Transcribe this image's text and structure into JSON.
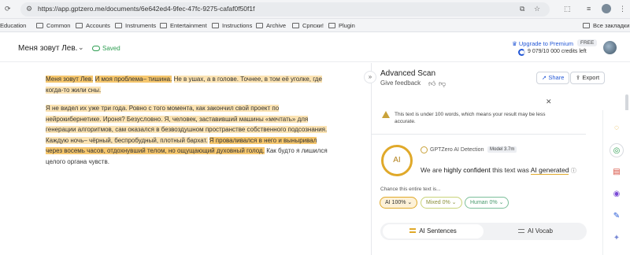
{
  "browser": {
    "url": "https://app.gptzero.me/documents/6e642ed4-9fec-47fc-9275-cafaf0f50f1f",
    "bookmarks": [
      "Education",
      "Common",
      "Accounts",
      "Instruments",
      "Entertainment",
      "Instructions",
      "Archive",
      "Српски!",
      "Plugin"
    ],
    "all_bookmarks": "Все закладки"
  },
  "header": {
    "doc_title": "Меня зовут Лев.",
    "saved": "Saved",
    "upgrade": "Upgrade to Premium",
    "plan_badge": "FREE",
    "credits": "9 079/10 000 credits left"
  },
  "editor": {
    "p1": {
      "s1": "Меня зовут Лев.",
      "s2": "И моя проблема– тишина.",
      "s3": "Не в ушах, а в голове. Точнее, в том её уголке, где когда-то жили сны."
    },
    "p2": {
      "s1": "Я не видел их уже три года. Ровно с того момента, как закончил свой проект по нейрокибернетике. Ироня? Безусловно. Я, человек, заставивший машины «мечтать» для генерации алгоритмов, сам оказался в безвоздушном пространстве собственного подсознания. Каждую ночь– чёрный, беспробудный, плотный бархат.",
      "s2": "Я проваливался в него и выныривал через восемь часов, отдохнувший телом, но ощущающий духовный голод.",
      "s3": "Как будто я лишился целого органа чувств."
    }
  },
  "panel": {
    "title": "Advanced Scan",
    "feedback": "Give feedback",
    "share": "Share",
    "export": "Export",
    "warning": "This text is under 100 words, which means your result may be less accurate.",
    "detector": "GPTZero AI Detection",
    "model": "Model 3.7m",
    "score_label": "AI",
    "verdict_pre": "We are",
    "verdict_conf": "highly confident",
    "verdict_mid": "this text was",
    "verdict_ai": "AI generated",
    "chance": "Chance this entire text is...",
    "pill_ai": "AI 100%",
    "pill_mixed": "Mixed 0%",
    "pill_human": "Human 0%",
    "tab_sentences": "AI Sentences",
    "tab_vocab": "AI Vocab"
  },
  "colors": {
    "accent": "#2458d6",
    "ai_highlight": "#f6c76e",
    "ai_light": "#fbe3b3"
  }
}
